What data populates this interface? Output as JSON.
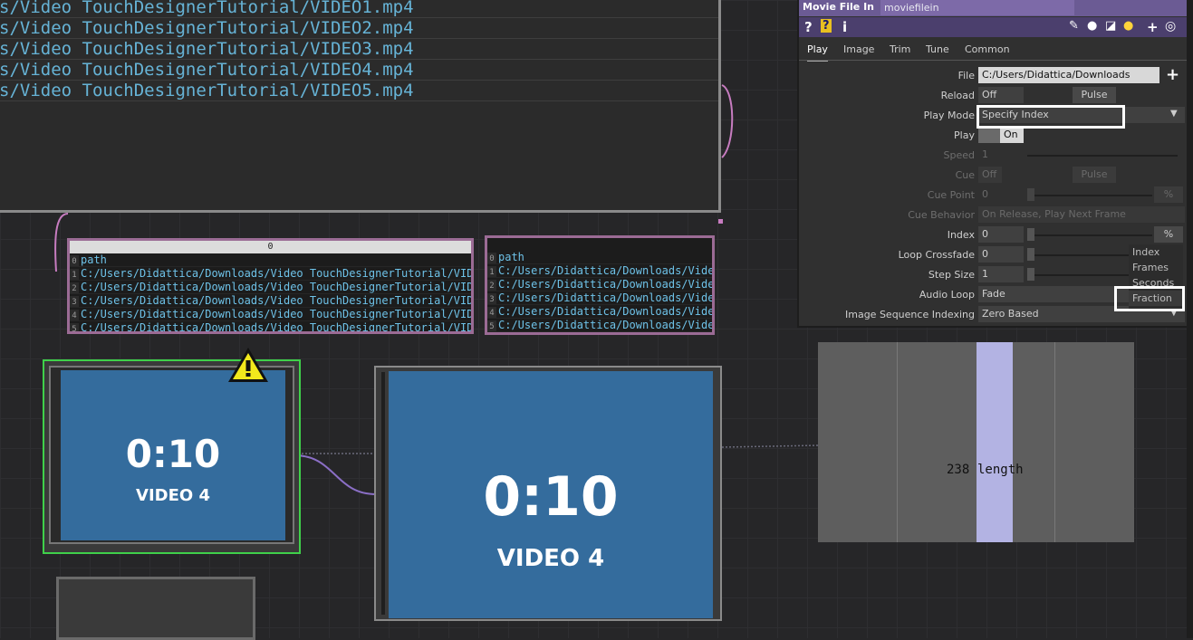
{
  "text_dat": {
    "lines": [
      "s/Video TouchDesignerTutorial/VIDEO1.mp4",
      "s/Video TouchDesignerTutorial/VIDEO2.mp4",
      "s/Video TouchDesignerTutorial/VIDEO3.mp4",
      "s/Video TouchDesignerTutorial/VIDEO4.mp4",
      "s/Video TouchDesignerTutorial/VIDEO5.mp4"
    ]
  },
  "table_left": {
    "header": "0",
    "rows": [
      {
        "idx": "0",
        "val": "path"
      },
      {
        "idx": "1",
        "val": "C:/Users/Didattica/Downloads/Video TouchDesignerTutorial/VIDE"
      },
      {
        "idx": "2",
        "val": "C:/Users/Didattica/Downloads/Video TouchDesignerTutorial/VIDE"
      },
      {
        "idx": "3",
        "val": "C:/Users/Didattica/Downloads/Video TouchDesignerTutorial/VIDE"
      },
      {
        "idx": "4",
        "val": "C:/Users/Didattica/Downloads/Video TouchDesignerTutorial/VIDE"
      },
      {
        "idx": "5",
        "val": "C:/Users/Didattica/Downloads/Video TouchDesignerTutorial/VIDE"
      }
    ]
  },
  "table_right": {
    "rows": [
      {
        "idx": "0",
        "val": "path"
      },
      {
        "idx": "1",
        "val": "C:/Users/Didattica/Downloads/Vide"
      },
      {
        "idx": "2",
        "val": "C:/Users/Didattica/Downloads/Vide"
      },
      {
        "idx": "3",
        "val": "C:/Users/Didattica/Downloads/Vide"
      },
      {
        "idx": "4",
        "val": "C:/Users/Didattica/Downloads/Vide"
      },
      {
        "idx": "5",
        "val": "C:/Users/Didattica/Downloads/Vide"
      }
    ]
  },
  "video_small": {
    "time": "0:10",
    "label": "VIDEO 4"
  },
  "video_large": {
    "time": "0:10",
    "label": "VIDEO 4"
  },
  "chop": {
    "value": "238",
    "channel": "length"
  },
  "panel": {
    "type": "Movie File In",
    "name": "moviefilein",
    "icons": [
      "help-icon",
      "python-help-icon",
      "info-icon",
      "pencil-icon",
      "comment-icon",
      "clone-icon",
      "python-icon",
      "plus-icon",
      "target-icon"
    ],
    "tabs": [
      "Play",
      "Image",
      "Trim",
      "Tune",
      "Common"
    ],
    "active_tab": "Play",
    "params": {
      "file": {
        "label": "File",
        "value": "C:/Users/Didattica/Downloads"
      },
      "reload": {
        "label": "Reload",
        "value": "Off",
        "button": "Pulse"
      },
      "playmode": {
        "label": "Play Mode",
        "value": "Specify Index"
      },
      "play": {
        "label": "Play",
        "value": "On"
      },
      "speed": {
        "label": "Speed",
        "value": "1"
      },
      "cue": {
        "label": "Cue",
        "value": "Off",
        "button": "Pulse"
      },
      "cuepoint": {
        "label": "Cue Point",
        "value": "0",
        "unit": "%"
      },
      "cuebehavior": {
        "label": "Cue Behavior",
        "value": "On Release, Play Next Frame"
      },
      "index": {
        "label": "Index",
        "value": "0",
        "unit": "%"
      },
      "loopcrossfade": {
        "label": "Loop Crossfade",
        "value": "0"
      },
      "stepsize": {
        "label": "Step Size",
        "value": "1"
      },
      "audioloop": {
        "label": "Audio Loop",
        "value": "Fade"
      },
      "imageseq": {
        "label": "Image Sequence Indexing",
        "value": "Zero Based"
      }
    },
    "unit_menu": [
      "Index",
      "Frames",
      "Seconds",
      "Fraction"
    ]
  },
  "colors": {
    "panel_title": "#6b5b94",
    "video_bg": "#346c9d",
    "table_border": "#9b6b95",
    "selected_node": "#3fd04a",
    "highlight": "#ffffff"
  }
}
